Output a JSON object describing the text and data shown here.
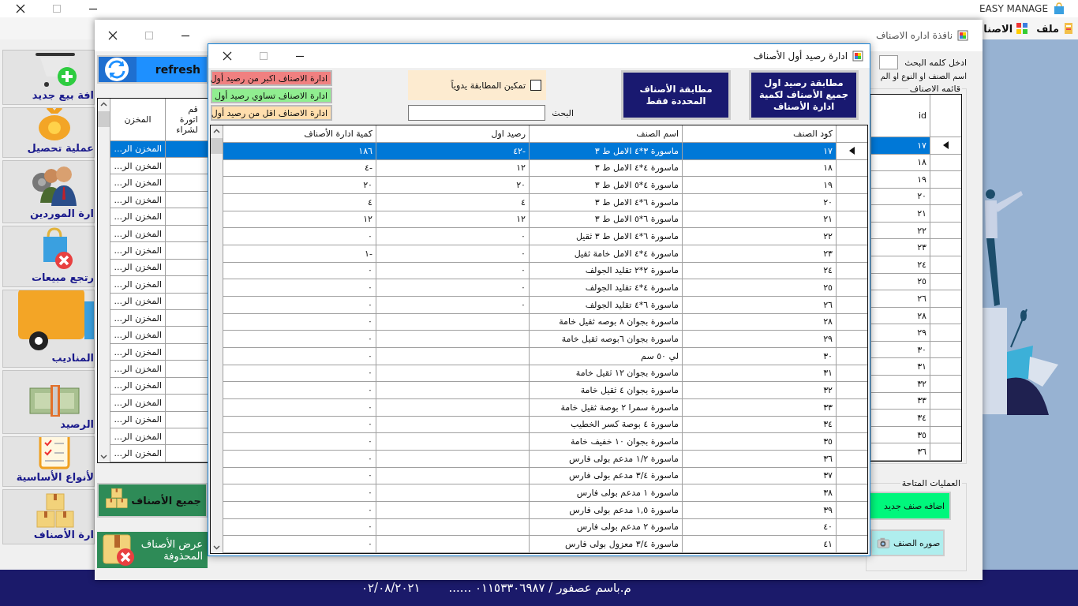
{
  "app": {
    "title": "EASY MANAGE",
    "menu": [
      {
        "label": "ملف"
      },
      {
        "label": "الاصنا"
      }
    ]
  },
  "sidebar": {
    "items": [
      {
        "label": "افة بيع جديد",
        "kind": "cart"
      },
      {
        "label": "عملية تحصيل",
        "kind": "moneybag"
      },
      {
        "label": "ارة الموردين",
        "kind": "people"
      },
      {
        "label": "رتجع مبيعات",
        "kind": "bag"
      },
      {
        "label": "المناديب",
        "kind": "truck"
      },
      {
        "label": "الرصيد",
        "kind": "cash"
      },
      {
        "label": "لأنواع الأساسية",
        "kind": "clipboard"
      },
      {
        "label": "ارة الأصناف",
        "kind": "boxes"
      }
    ]
  },
  "items_window": {
    "title": "نافذة اداره الاصناف",
    "refresh": "refresh",
    "store_table": {
      "columns": [
        "قم\nاتورة\nلشراء",
        "المخزن"
      ],
      "rows": [
        {
          "store": "المخزن الر...",
          "selected": true
        },
        {
          "store": "المخزن الر...",
          "selected": false
        },
        {
          "store": "المخزن الر...",
          "selected": false
        },
        {
          "store": "المخزن الر...",
          "selected": false
        },
        {
          "store": "المخزن الر...",
          "selected": false
        },
        {
          "store": "المخزن الر...",
          "selected": false
        },
        {
          "store": "المخزن الر...",
          "selected": false
        },
        {
          "store": "المخزن الر...",
          "selected": false
        },
        {
          "store": "المخزن الر...",
          "selected": false
        },
        {
          "store": "المخزن الر...",
          "selected": false
        },
        {
          "store": "المخزن الر...",
          "selected": false
        },
        {
          "store": "المخزن الر...",
          "selected": false
        },
        {
          "store": "المخزن الر...",
          "selected": false
        },
        {
          "store": "المخزن الر...",
          "selected": false
        },
        {
          "store": "المخزن الر...",
          "selected": false
        },
        {
          "store": "المخزن الر...",
          "selected": false
        },
        {
          "store": "المخزن الر...",
          "selected": false
        },
        {
          "store": "المخزن الر...",
          "selected": false
        },
        {
          "store": "المخزن الر...",
          "selected": false
        }
      ]
    },
    "all_items": "جميع الأصناف",
    "deleted_items": "عرض الأصناف المحذوفة",
    "search_label": "ادخل كلمه البحث",
    "search_hint": "اسم الصنف او النوع او الم",
    "list_title": "قائمه الاصناف",
    "items_list": {
      "columns": [
        "id"
      ],
      "rows": [
        {
          "id": "١٧",
          "selected": true
        },
        {
          "id": "١٨",
          "selected": false
        },
        {
          "id": "١٩",
          "selected": false
        },
        {
          "id": "٢٠",
          "selected": false
        },
        {
          "id": "٢١",
          "selected": false
        },
        {
          "id": "٢٢",
          "selected": false
        },
        {
          "id": "٢٣",
          "selected": false
        },
        {
          "id": "٢٤",
          "selected": false
        },
        {
          "id": "٢٥",
          "selected": false
        },
        {
          "id": "٢٦",
          "selected": false
        },
        {
          "id": "٢٨",
          "selected": false
        },
        {
          "id": "٢٩",
          "selected": false
        },
        {
          "id": "٣٠",
          "selected": false
        },
        {
          "id": "٣١",
          "selected": false
        },
        {
          "id": "٣٢",
          "selected": false
        },
        {
          "id": "٣٣",
          "selected": false
        },
        {
          "id": "٣٤",
          "selected": false
        },
        {
          "id": "٣٥",
          "selected": false
        },
        {
          "id": "٣٦",
          "selected": false
        }
      ]
    },
    "operations_title": "العمليات المتاحة",
    "operations": [
      {
        "label": "اضافه صنف جديد",
        "kind": "add"
      },
      {
        "label": "صوره الصنف"
      }
    ]
  },
  "dialog": {
    "title": "ادارة رصيد أول الأصناف",
    "filters": [
      {
        "label": "ادارة الاصناف اكبر من رصيد أول",
        "color": "#f08080"
      },
      {
        "label": "ادارة الاصناف تساوي رصيد أول",
        "color": "#90ee90"
      },
      {
        "label": "ادارة الاصناف اقل من رصيد أول",
        "color": "#ffdead"
      }
    ],
    "manual_match": {
      "label": "تمكين المطابقة يدوياً",
      "checked": false
    },
    "search_label": "البحث",
    "actions": [
      "مطابقة رصيد اول جميع الأصناف لكمية ادارة الأصناف",
      "مطابقة الأصناف المحددة فقط"
    ],
    "table": {
      "columns": [
        "كود الصنف",
        "اسم الصنف",
        "رصيد اول",
        "كمية ادارة الأصناف"
      ],
      "rows": [
        {
          "code": "١٧",
          "name": "ماسورة ٣*٤ الامل ط ٣",
          "opening": "-٤٢",
          "quantity": "١٨٦",
          "selected": true
        },
        {
          "code": "١٨",
          "name": "ماسورة ٤*٤ الامل ط ٣",
          "opening": "١٢",
          "quantity": "-٤",
          "selected": false
        },
        {
          "code": "١٩",
          "name": "ماسورة ٤*٥ الامل ط ٣",
          "opening": "٢٠",
          "quantity": "٢٠",
          "selected": false
        },
        {
          "code": "٢٠",
          "name": "ماسورة ٦*٤ الامل ط ٣",
          "opening": "٤",
          "quantity": "٤",
          "selected": false
        },
        {
          "code": "٢١",
          "name": "ماسورة ٦*٥ الامل ط ٣",
          "opening": "١٢",
          "quantity": "١٢",
          "selected": false
        },
        {
          "code": "٢٢",
          "name": "ماسورة ٦*٤ الامل ط ٣ ثقيل",
          "opening": "٠",
          "quantity": "٠",
          "selected": false
        },
        {
          "code": "٢٣",
          "name": "ماسورة ٤*٤ الامل خامة ثقيل",
          "opening": "٠",
          "quantity": "-١",
          "selected": false
        },
        {
          "code": "٢٤",
          "name": "ماسورة ٢*٢ تقليد الجولف",
          "opening": "٠",
          "quantity": "٠",
          "selected": false
        },
        {
          "code": "٢٥",
          "name": "ماسورة ٤*٤ تقليد الجولف",
          "opening": "٠",
          "quantity": "٠",
          "selected": false
        },
        {
          "code": "٢٦",
          "name": "ماسورة ٦*٤ تقليد الجولف",
          "opening": "٠",
          "quantity": "٠",
          "selected": false
        },
        {
          "code": "٢٨",
          "name": "ماسورة بجوان ٨ بوصه ثقيل خامة",
          "quantity": "٠",
          "selected": false
        },
        {
          "code": "٢٩",
          "name": "ماسورة بجوان ٦بوصه ثقيل خامة",
          "quantity": "٠",
          "selected": false
        },
        {
          "code": "٣٠",
          "name": "لي ٥٠ سم",
          "quantity": "٠",
          "selected": false
        },
        {
          "code": "٣١",
          "name": "ماسورة بجوان ١٢ ثقيل خامة",
          "quantity": "٠",
          "selected": false
        },
        {
          "code": "٣٢",
          "name": "ماسورة بجوان ٤ ثقيل خامة",
          "quantity": "٠",
          "selected": false
        },
        {
          "code": "٣٣",
          "name": "ماسورة سمرا ٢ بوصة ثقيل خامة",
          "quantity": "٠",
          "selected": false
        },
        {
          "code": "٣٤",
          "name": "ماسورة ٤ بوصة كسر الخطيب",
          "quantity": "٠",
          "selected": false
        },
        {
          "code": "٣٥",
          "name": "ماسورة بجوان ١٠ خفيف خامة",
          "quantity": "٠",
          "selected": false
        },
        {
          "code": "٣٦",
          "name": "ماسورة ١/٢ مدعم بولى فارس",
          "quantity": "٠",
          "selected": false
        },
        {
          "code": "٣٧",
          "name": "ماسورة ٣/٤ مدعم بولى فارس",
          "quantity": "٠",
          "selected": false
        },
        {
          "code": "٣٨",
          "name": "ماسورة ١ مدعم بولى فارس",
          "quantity": "٠",
          "selected": false
        },
        {
          "code": "٣٩",
          "name": "ماسورة ١,٥ مدعم بولى فارس",
          "quantity": "٠",
          "selected": false
        },
        {
          "code": "٤٠",
          "name": "ماسورة ٢ مدعم بولى فارس",
          "quantity": "٠",
          "selected": false
        },
        {
          "code": "٤١",
          "name": "ماسورة ٣/٤ معزول بولى فارس",
          "quantity": "٠",
          "selected": false
        }
      ]
    }
  },
  "status_bar": {
    "author": "م.باسم عصفور / ٠١١٥٣٣٠٦٩٨٧ ......",
    "date": "٠٢/٠٨/٢٠٢١"
  }
}
